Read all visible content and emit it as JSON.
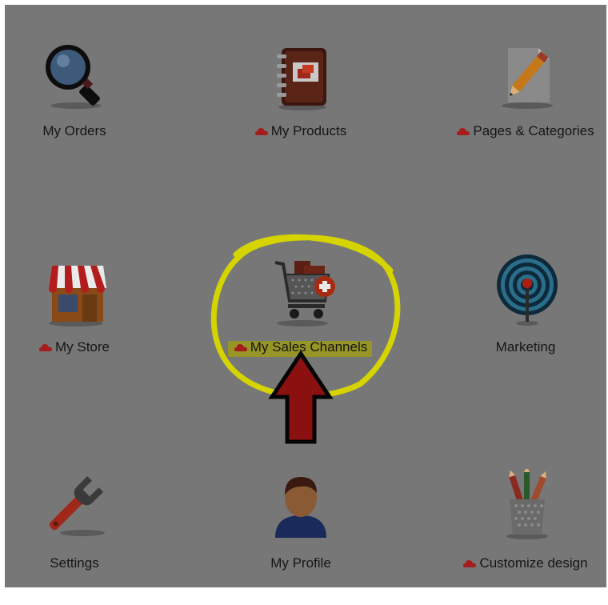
{
  "dashboard": {
    "tiles": [
      {
        "label": "My Orders",
        "icon": "magnifier-icon",
        "cloud": false
      },
      {
        "label": "My Products",
        "icon": "notebook-icon",
        "cloud": true
      },
      {
        "label": "Pages & Categories",
        "icon": "page-pencil-icon",
        "cloud": true
      },
      {
        "label": "My Store",
        "icon": "storefront-icon",
        "cloud": true
      },
      {
        "label": "My Sales Channels",
        "icon": "cart-add-icon",
        "cloud": true
      },
      {
        "label": "Marketing",
        "icon": "antenna-icon",
        "cloud": false
      },
      {
        "label": "Settings",
        "icon": "wrench-icon",
        "cloud": false
      },
      {
        "label": "My Profile",
        "icon": "person-icon",
        "cloud": false
      },
      {
        "label": "Customize design",
        "icon": "pencil-cup-icon",
        "cloud": true
      }
    ]
  },
  "annotation": {
    "highlight_color": "#d6d400",
    "arrow_color": "#8b1010",
    "target": "My Sales Channels"
  },
  "colors": {
    "background": "#777777",
    "label": "#151515",
    "cloud": "#a51c1c"
  }
}
